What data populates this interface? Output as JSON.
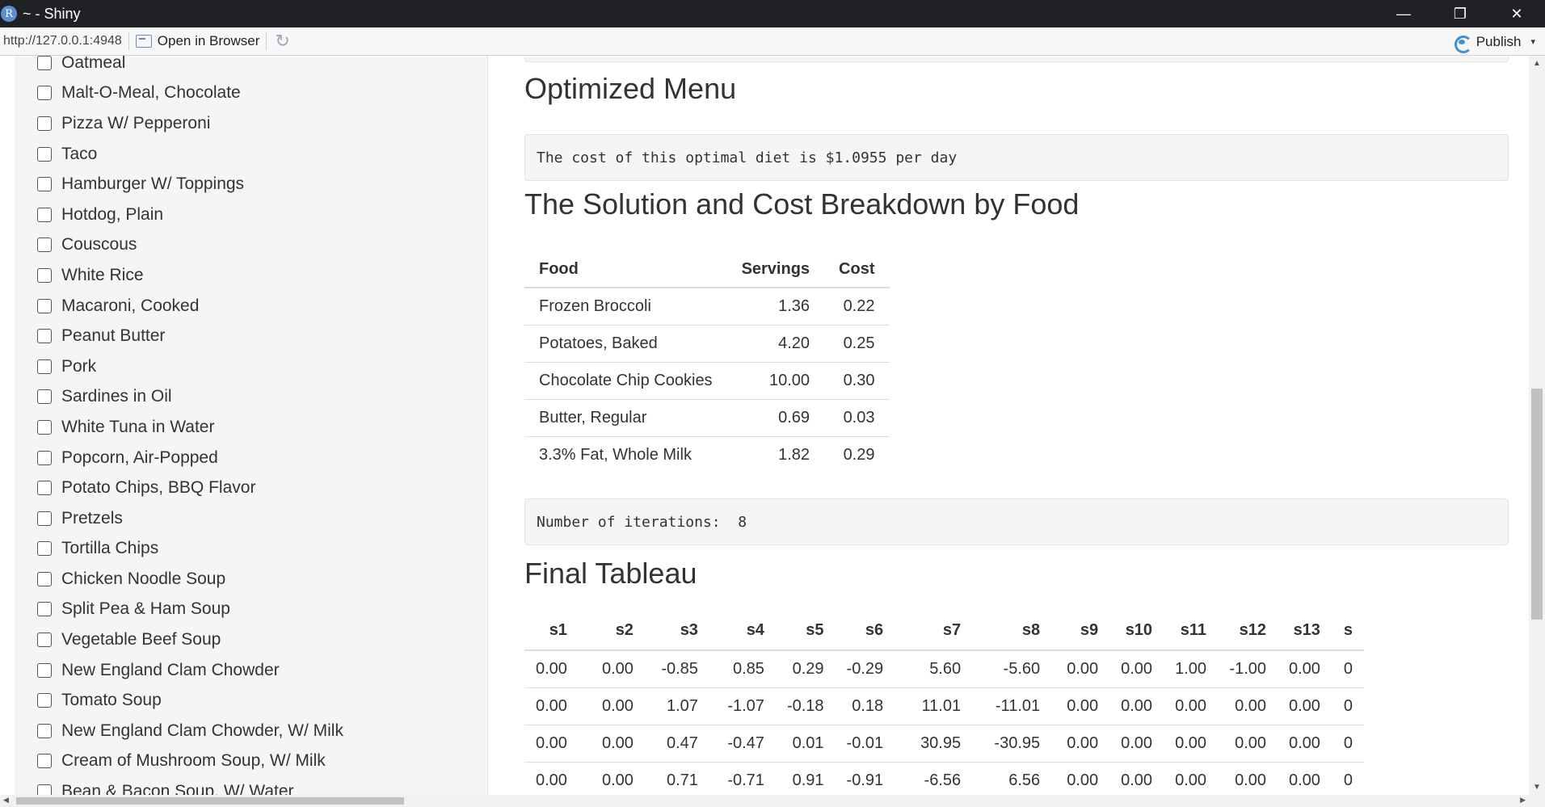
{
  "window": {
    "app_icon": "R",
    "title": "~ - Shiny",
    "minimize": "—",
    "restore": "❐",
    "close": "✕"
  },
  "toolbar": {
    "url": "http://127.0.0.1:4948",
    "open_browser": "Open in Browser",
    "refresh_icon": "↻",
    "publish": "Publish",
    "caret": "▾"
  },
  "sidebar": {
    "foods": [
      "Oatmeal",
      "Malt-O-Meal, Chocolate",
      "Pizza W/ Pepperoni",
      "Taco",
      "Hamburger W/ Toppings",
      "Hotdog, Plain",
      "Couscous",
      "White Rice",
      "Macaroni, Cooked",
      "Peanut Butter",
      "Pork",
      "Sardines in Oil",
      "White Tuna in Water",
      "Popcorn, Air-Popped",
      "Potato Chips, BBQ Flavor",
      "Pretzels",
      "Tortilla Chips",
      "Chicken Noodle Soup",
      "Split Pea & Ham Soup",
      "Vegetable Beef Soup",
      "New England Clam Chowder",
      "Tomato Soup",
      "New England Clam Chowder, W/ Milk",
      "Cream of Mushroom Soup, W/ Milk",
      "Bean & Bacon Soup, W/ Water"
    ]
  },
  "main": {
    "optimized_heading": "Optimized Menu",
    "cost_text": "The cost of this optimal diet is $1.0955 per day",
    "solution_heading": "The Solution and Cost Breakdown by Food",
    "solution_table": {
      "headers": [
        "Food",
        "Servings",
        "Cost"
      ],
      "rows": [
        [
          "Frozen Broccoli",
          "1.36",
          "0.22"
        ],
        [
          "Potatoes, Baked",
          "4.20",
          "0.25"
        ],
        [
          "Chocolate Chip Cookies",
          "10.00",
          "0.30"
        ],
        [
          "Butter, Regular",
          "0.69",
          "0.03"
        ],
        [
          "3.3% Fat, Whole Milk",
          "1.82",
          "0.29"
        ]
      ]
    },
    "iterations_text": "Number of iterations:  8",
    "tableau_heading": "Final Tableau",
    "tableau": {
      "headers": [
        "s1",
        "s2",
        "s3",
        "s4",
        "s5",
        "s6",
        "s7",
        "s8",
        "s9",
        "s10",
        "s11",
        "s12",
        "s13",
        "s"
      ],
      "rows": [
        [
          "0.00",
          "0.00",
          "-0.85",
          "0.85",
          "0.29",
          "-0.29",
          "5.60",
          "-5.60",
          "0.00",
          "0.00",
          "1.00",
          "-1.00",
          "0.00",
          "0"
        ],
        [
          "0.00",
          "0.00",
          "1.07",
          "-1.07",
          "-0.18",
          "0.18",
          "11.01",
          "-11.01",
          "0.00",
          "0.00",
          "0.00",
          "0.00",
          "0.00",
          "0"
        ],
        [
          "0.00",
          "0.00",
          "0.47",
          "-0.47",
          "0.01",
          "-0.01",
          "30.95",
          "-30.95",
          "0.00",
          "0.00",
          "0.00",
          "0.00",
          "0.00",
          "0"
        ],
        [
          "0.00",
          "0.00",
          "0.71",
          "-0.71",
          "0.91",
          "-0.91",
          "-6.56",
          "6.56",
          "0.00",
          "0.00",
          "0.00",
          "0.00",
          "0.00",
          "0"
        ]
      ]
    }
  }
}
